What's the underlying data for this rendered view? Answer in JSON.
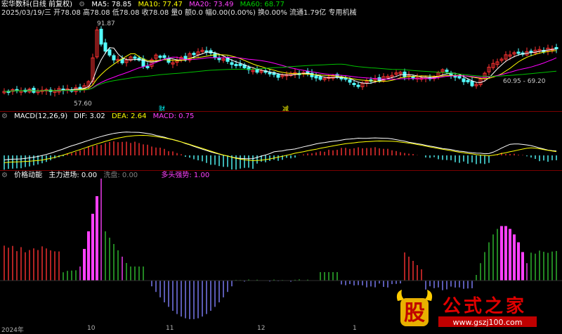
{
  "price_panel": {
    "title": "宏华数科(日线 前复权)",
    "ma5": "MA5: 78.85",
    "ma10": "MA10: 77.47",
    "ma20": "MA20: 73.49",
    "ma60": "MA60: 68.77",
    "quote": "2025/03/19/三 开78.08 高78.08 低78.08 收78.08 量0 额0.0 幅0.00(0.00%) 换0.00% 流通1.79亿 专用机械",
    "high_label": "91.87",
    "low_label": "57.60",
    "right_label": "60.95 - 69.20",
    "event_cai": "财",
    "event_jian": "减"
  },
  "macd_panel": {
    "title": "MACD(12,26,9)",
    "dif": "DIF: 3.02",
    "dea": "DEA: 2.64",
    "macd": "MACD: 0.75"
  },
  "momentum_panel": {
    "title": "价格动能",
    "main_entry": "主力进场: 0.00",
    "washout": "洗盘: 0.00",
    "bull_strong": "多头强势: 1.00"
  },
  "x_axis": [
    "2024年",
    "10",
    "11",
    "12",
    "1"
  ],
  "watermark": {
    "brand": "股",
    "name": "公式之家",
    "url": "www.gszj100.com"
  },
  "colors": {
    "up": "#ff3232",
    "down": "#54ffff",
    "ma5": "#ffffff",
    "ma10": "#ffff00",
    "ma20": "#ff00ff",
    "ma60": "#00c000",
    "magenta": "#ff40ff"
  }
}
